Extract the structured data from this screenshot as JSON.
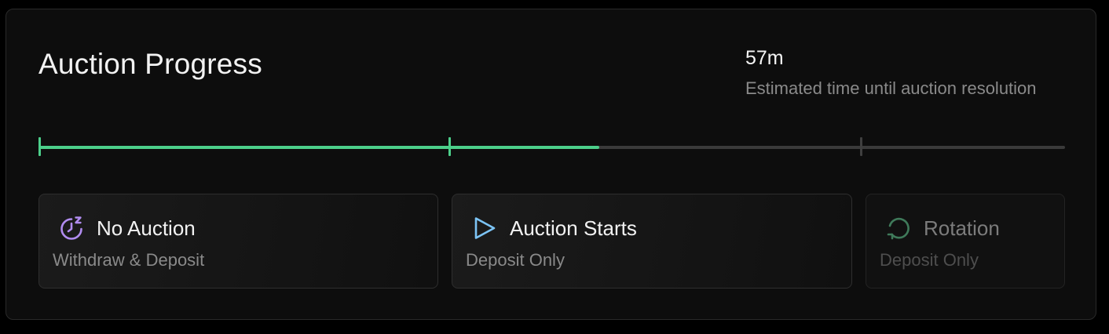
{
  "header": {
    "title": "Auction Progress"
  },
  "countdown": {
    "value": "57m",
    "caption": "Estimated time until auction resolution"
  },
  "progress": {
    "fraction": 0.546,
    "fill_color": "#4ccf8a",
    "track_color": "#3a3a3a"
  },
  "phases": [
    {
      "label": "No Auction",
      "sublabel": "Withdraw & Deposit",
      "icon": "timer-snooze-icon",
      "icon_color": "#b18cf0",
      "state": "complete"
    },
    {
      "label": "Auction Starts",
      "sublabel": "Deposit Only",
      "icon": "play-icon",
      "icon_color": "#7cc4f5",
      "state": "active"
    },
    {
      "label": "Rotation",
      "sublabel": "Deposit Only",
      "icon": "rotate-icon",
      "icon_color": "#3f7a5a",
      "state": "upcoming"
    }
  ]
}
